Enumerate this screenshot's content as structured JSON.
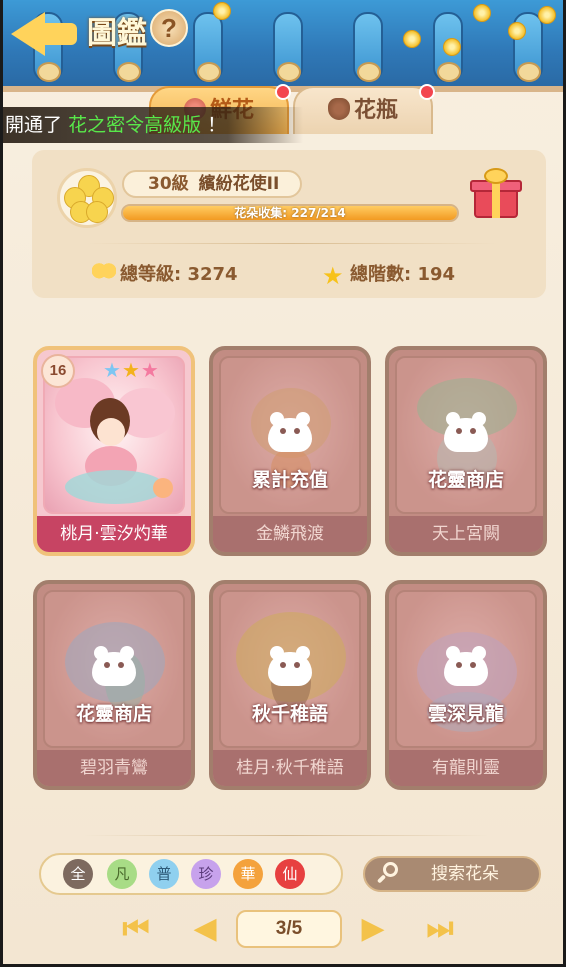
{
  "header": {
    "title": "圖鑑",
    "help_label": "?"
  },
  "tabs": [
    {
      "label": "鮮花",
      "active": true,
      "badge": true
    },
    {
      "label": "花瓶",
      "active": false,
      "badge": true
    }
  ],
  "marquee": {
    "prefix": "開通了",
    "highlight": "花之密令高級版",
    "suffix": "！"
  },
  "profile": {
    "level": "30級",
    "rank_title": "繽紛花使II",
    "progress_text": "花朵收集: 227/214",
    "progress_fraction": 1.0,
    "total_level_label": "總等級: 3274",
    "total_stars_label": "總階數: 194"
  },
  "cards": [
    {
      "name": "桃月·雲汐灼華",
      "unlocked": true,
      "level": "16",
      "lock_text": ""
    },
    {
      "name": "金鱗飛渡",
      "unlocked": false,
      "level": "",
      "lock_text": "累計充值"
    },
    {
      "name": "天上宮闕",
      "unlocked": false,
      "level": "",
      "lock_text": "花靈商店"
    },
    {
      "name": "碧羽青鸞",
      "unlocked": false,
      "level": "",
      "lock_text": "花靈商店"
    },
    {
      "name": "桂月·秋千稚語",
      "unlocked": false,
      "level": "",
      "lock_text": "秋千稚語"
    },
    {
      "name": "有龍則靈",
      "unlocked": false,
      "level": "",
      "lock_text": "雲深見龍"
    }
  ],
  "filters": [
    {
      "label": "全",
      "bg": "#7d6a5f",
      "fg": "#ffffff"
    },
    {
      "label": "凡",
      "bg": "#a8dc86",
      "fg": "#4a6a2c"
    },
    {
      "label": "普",
      "bg": "#8fd0ef",
      "fg": "#2c5a78"
    },
    {
      "label": "珍",
      "bg": "#c7a2ec",
      "fg": "#5a3a7a"
    },
    {
      "label": "華",
      "bg": "#f4a23c",
      "fg": "#ffffff"
    },
    {
      "label": "仙",
      "bg": "#e74040",
      "fg": "#ffffff"
    }
  ],
  "search": {
    "placeholder": "搜索花朵"
  },
  "pager": {
    "page_label": "3/5"
  },
  "colors": {
    "roof_blue": "#3d9ad6",
    "accent_gold": "#ffd35b",
    "unlocked_name_bar": "#c74463",
    "locked_name_bar": "#a9706e"
  }
}
